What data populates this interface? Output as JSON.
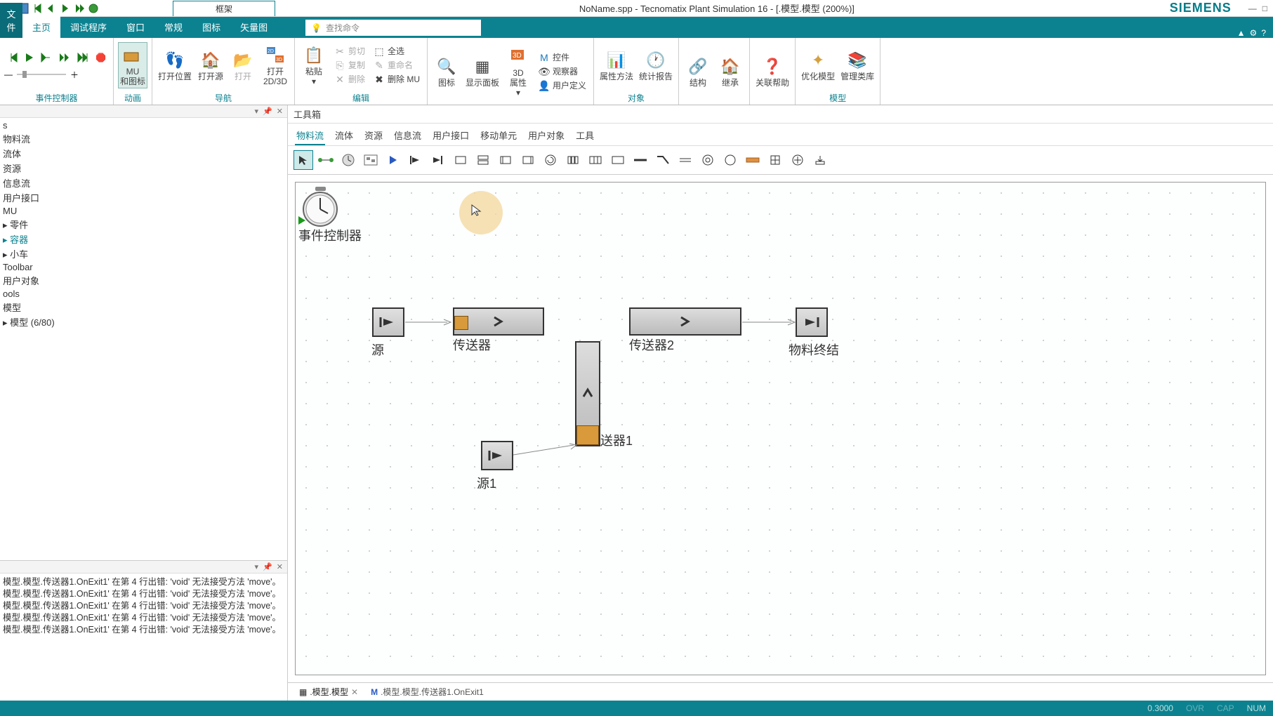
{
  "title_bar": {
    "frame_tab": "框架",
    "title": "NoName.spp - Tecnomatix Plant Simulation 16 - [.模型.模型 (200%)]",
    "brand": "SIEMENS"
  },
  "ribbon_tabs": {
    "file": "文件",
    "home": "主页",
    "debug": "调试程序",
    "window": "窗口",
    "general": "常规",
    "icon": "图标",
    "vector": "矢量图",
    "search_placeholder": "查找命令"
  },
  "ribbon": {
    "event_controller": "事件控制器",
    "mu_icon": "MU\n和图标",
    "open_pos": "打开位置",
    "open_origin": "打开源",
    "open": "打开",
    "open_2d3d": "打开\n2D/3D",
    "nav": "导航",
    "paste": "粘贴",
    "cut": "剪切",
    "copy": "复制",
    "delete": "删除",
    "select_all": "全选",
    "rename": "重命名",
    "delete_mu": "删除 MU",
    "edit": "编辑",
    "icons": "图标",
    "show_panel": "显示面板",
    "attr_3d": "3D\n属性",
    "controls": "控件",
    "observer": "观察器",
    "user_def": "用户定义",
    "attr_method": "属性方法",
    "stats": "统计报告",
    "object": "对象",
    "structure": "结构",
    "inherit": "继承",
    "context_help": "关联帮助",
    "optimize": "优化模型",
    "manage_lib": "管理类库",
    "model": "模型"
  },
  "tree": {
    "items": [
      "s",
      "物料流",
      "流体",
      "资源",
      "信息流",
      "用户接口",
      "MU",
      "零件",
      "容器",
      "小车",
      "Toolbar",
      "用户对象",
      "ools",
      "模型",
      "模型 (6/80)"
    ]
  },
  "console": {
    "lines": [
      "模型.模型.传送器1.OnExit1' 在第 4 行出错: 'void' 无法接受方法 'move'。",
      "模型.模型.传送器1.OnExit1' 在第 4 行出错: 'void' 无法接受方法 'move'。",
      "模型.模型.传送器1.OnExit1' 在第 4 行出错: 'void' 无法接受方法 'move'。",
      "模型.模型.传送器1.OnExit1' 在第 4 行出错: 'void' 无法接受方法 'move'。",
      "模型.模型.传送器1.OnExit1' 在第 4 行出错: 'void' 无法接受方法 'move'。"
    ]
  },
  "toolbox": {
    "title": "工具箱",
    "tabs": [
      "物料流",
      "流体",
      "资源",
      "信息流",
      "用户接口",
      "移动单元",
      "用户对象",
      "工具"
    ]
  },
  "canvas": {
    "event_controller": "事件控制器",
    "source": "源",
    "conveyor": "传送器",
    "conveyor2": "传送器2",
    "drain": "物料终结",
    "source1": "源1",
    "conveyor1_partial": "送器1"
  },
  "doc_tabs": {
    "t1": ".模型.模型",
    "t2": ".模型.模型.传送器1.OnExit1"
  },
  "status": {
    "value": "0.3000",
    "ovr": "OVR",
    "cap": "CAP",
    "num": "NUM"
  }
}
